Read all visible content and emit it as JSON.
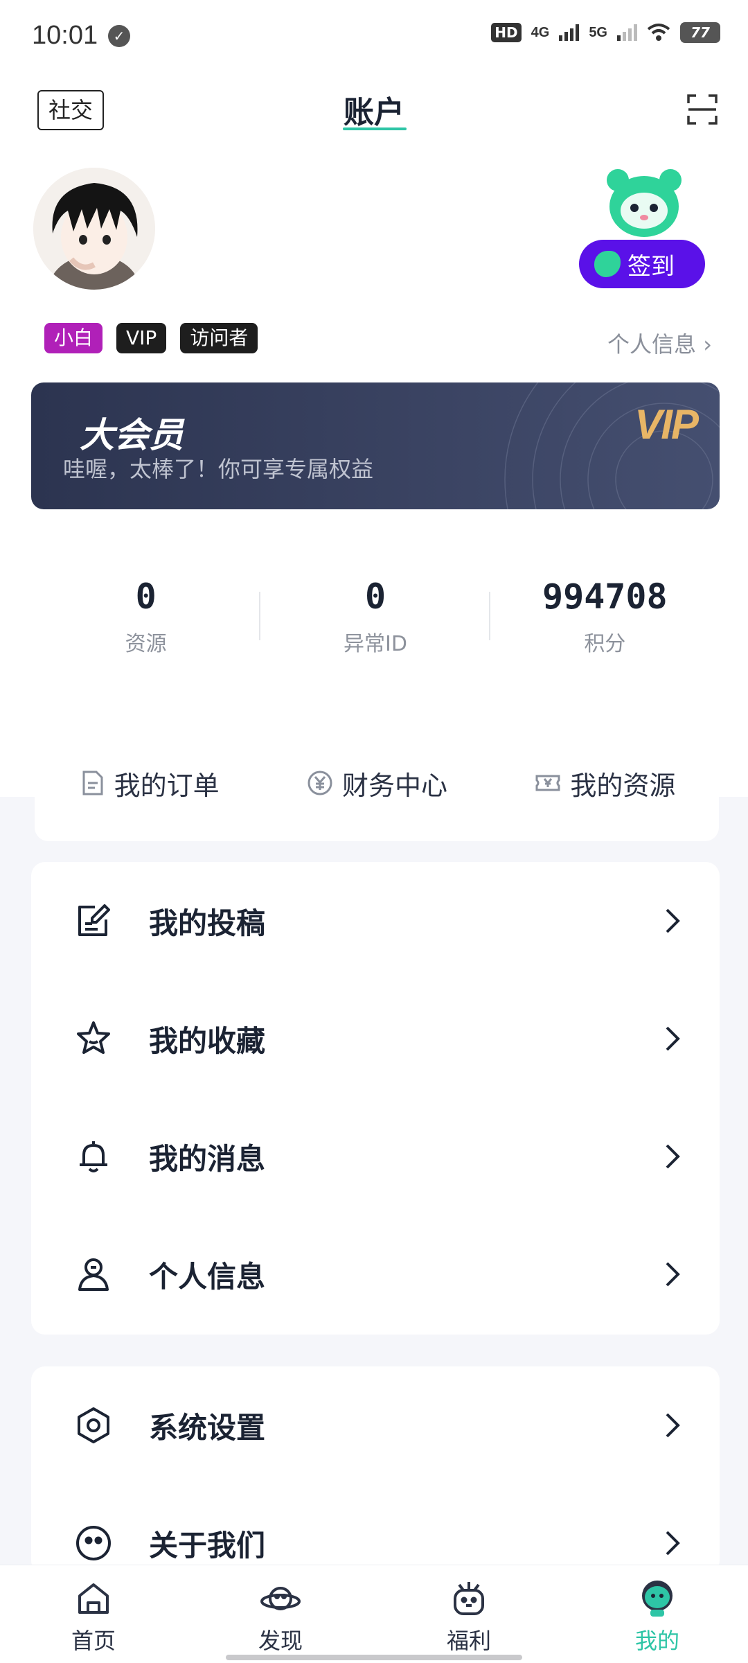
{
  "status_bar": {
    "time": "10:01",
    "battery": "77",
    "network_1": "4G",
    "network_2": "5G",
    "hd": "HD"
  },
  "header": {
    "social_label": "社交",
    "title": "账户"
  },
  "profile": {
    "signin_label": "签到",
    "tags": [
      "小白",
      "VIP",
      "访问者"
    ],
    "profile_link": "个人信息 ›"
  },
  "vip_banner": {
    "title": "大会员",
    "subtitle": "哇喔，太棒了！你可享专属权益",
    "logo": "VIP"
  },
  "stats": [
    {
      "value": "0",
      "label": "资源"
    },
    {
      "value": "0",
      "label": "异常ID"
    },
    {
      "value": "994708",
      "label": "积分"
    }
  ],
  "quick_actions": [
    {
      "label": "我的订单",
      "icon": "document-icon"
    },
    {
      "label": "财务中心",
      "icon": "yuan-coin-icon"
    },
    {
      "label": "我的资源",
      "icon": "ticket-icon"
    }
  ],
  "menu": [
    {
      "label": "我的投稿",
      "icon": "edit-note-icon"
    },
    {
      "label": "我的收藏",
      "icon": "star-icon"
    },
    {
      "label": "我的消息",
      "icon": "bell-icon"
    },
    {
      "label": "个人信息",
      "icon": "user-icon"
    }
  ],
  "menu2": [
    {
      "label": "系统设置",
      "icon": "settings-hex-icon"
    },
    {
      "label": "关于我们",
      "icon": "smiley-icon"
    }
  ],
  "bottom_nav": [
    {
      "label": "首页",
      "icon": "home-icon"
    },
    {
      "label": "发现",
      "icon": "planet-icon"
    },
    {
      "label": "福利",
      "icon": "gift-face-icon"
    },
    {
      "label": "我的",
      "icon": "profile-mascot-icon"
    }
  ],
  "colors": {
    "accent": "#2ec5a6",
    "signin": "#5a11e8",
    "tag_purple": "#b020b8",
    "vip_gold": "#e8b566"
  }
}
